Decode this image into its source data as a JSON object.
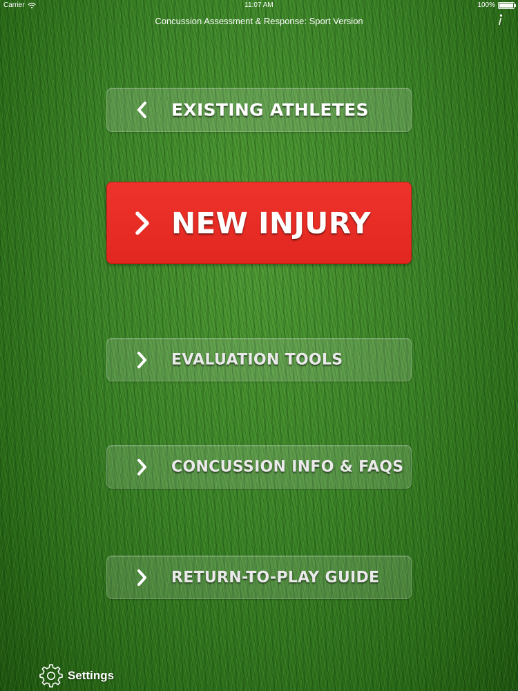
{
  "status_bar": {
    "carrier": "Carrier",
    "time": "11:07 AM",
    "battery": "100%"
  },
  "app": {
    "title": "Concussion Assessment & Response: Sport Version"
  },
  "menu": {
    "existing_athletes": "EXISTING ATHLETES",
    "new_injury": "NEW INJURY",
    "evaluation_tools": "EVALUATION TOOLS",
    "concussion_info": "CONCUSSION INFO & FAQS",
    "return_to_play": "RETURN-TO-PLAY GUIDE"
  },
  "footer": {
    "settings_label": "Settings"
  },
  "icons": {
    "back": "chevron-left-icon",
    "forward": "chevron-right-icon",
    "info": "info-icon",
    "settings": "gear-icon",
    "wifi": "wifi-icon",
    "battery": "battery-icon"
  },
  "colors": {
    "accent_red": "#e52b23",
    "text": "#ffffff",
    "background_grass": "#3c8428"
  }
}
